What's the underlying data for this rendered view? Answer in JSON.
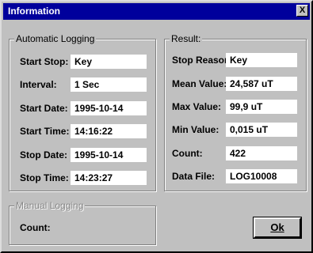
{
  "window": {
    "title": "Information",
    "close_label": "X"
  },
  "auto_logging": {
    "title": "Automatic Logging",
    "fields": [
      {
        "label": "Start Stop:",
        "value": "Key"
      },
      {
        "label": "Interval:",
        "value": "1 Sec"
      },
      {
        "label": "Start Date:",
        "value": "1995-10-14"
      },
      {
        "label": "Start Time:",
        "value": "14:16:22"
      },
      {
        "label": "Stop Date:",
        "value": "1995-10-14"
      },
      {
        "label": "Stop Time:",
        "value": "14:23:27"
      }
    ]
  },
  "result": {
    "title": "Result:",
    "fields": [
      {
        "label": "Stop Reason:",
        "value": "Key"
      },
      {
        "label": "Mean Value:",
        "value": "24,587 uT"
      },
      {
        "label": "Max Value:",
        "value": "99,9 uT"
      },
      {
        "label": "Min Value:",
        "value": "0,015 uT"
      },
      {
        "label": "Count:",
        "value": "422"
      },
      {
        "label": "Data File:",
        "value": "LOG10008"
      }
    ]
  },
  "manual_logging": {
    "title": "Manual Logging",
    "count_label": "Count:"
  },
  "ok_button": {
    "label": "Ok"
  }
}
